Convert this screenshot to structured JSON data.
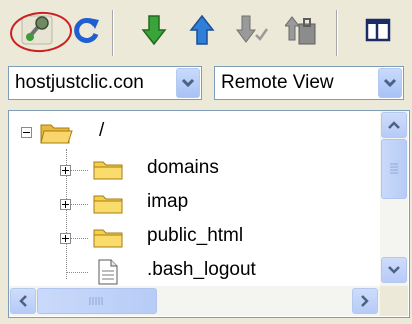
{
  "toolbar": {
    "buttons": [
      {
        "name": "connect-icon"
      },
      {
        "name": "refresh-icon"
      },
      {
        "name": "get-files-icon"
      },
      {
        "name": "put-files-icon"
      },
      {
        "name": "check-out-icon"
      },
      {
        "name": "check-in-icon"
      },
      {
        "name": "expand-view-icon"
      }
    ],
    "highlight_color": "#cc1f1f"
  },
  "site_select": {
    "value": "hostjustclic.con"
  },
  "view_select": {
    "value": "Remote View"
  },
  "tree": {
    "root": {
      "label": "/",
      "expander": "minus"
    },
    "items": [
      {
        "label": "domains",
        "type": "folder",
        "expander": "plus"
      },
      {
        "label": "imap",
        "type": "folder",
        "expander": "plus"
      },
      {
        "label": "public_html",
        "type": "folder",
        "expander": "plus"
      },
      {
        "label": ".bash_logout",
        "type": "file",
        "expander": "none"
      }
    ]
  },
  "colors": {
    "folder": "#f5cf4a",
    "scrollbar_accent": "#b7ccf6",
    "border": "#7f9db9"
  }
}
